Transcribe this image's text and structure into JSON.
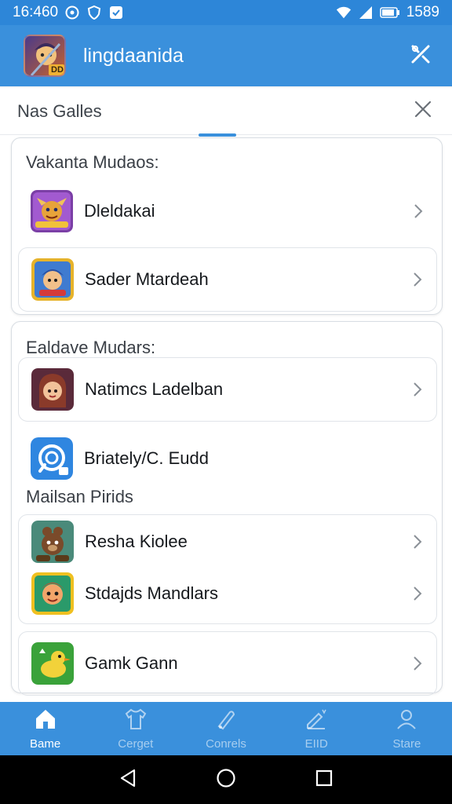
{
  "status_bar": {
    "time": "16:460",
    "battery": "1589",
    "icons": [
      "circle-info-icon",
      "shield-icon",
      "notification-icon",
      "wifi-icon",
      "signal-icon",
      "battery-icon"
    ]
  },
  "app_bar": {
    "title": "lingdaanida",
    "logo_badge": "DD",
    "action_icon": "tools-icon"
  },
  "sheet": {
    "title": "Nas Galles",
    "close_icon": "close-icon",
    "section1": {
      "heading": "Vakanta Mudaos:",
      "items": [
        {
          "label": "Dleldakai",
          "icon": "game-icon-purple"
        },
        {
          "label": "Sader Mtardeah",
          "icon": "game-icon-blue"
        }
      ]
    },
    "section2": {
      "heading": "Ealdave Mudars:",
      "items": [
        {
          "label": "Natimcs Ladelban",
          "icon": "game-icon-maroon"
        },
        {
          "label": "Briately/C. Eudd",
          "icon": "app-icon-blue"
        }
      ],
      "subheading": "Mailsan Pirids",
      "group_items": [
        {
          "label": "Resha Kiolee",
          "icon": "game-icon-brown"
        },
        {
          "label": "Stdajds Mandlars",
          "icon": "game-icon-yellow"
        }
      ],
      "last_item": {
        "label": "Gamk Gann",
        "icon": "game-icon-green"
      }
    }
  },
  "bottom_nav": {
    "items": [
      {
        "label": "Bame",
        "icon": "home-icon",
        "active": true
      },
      {
        "label": "Cerget",
        "icon": "shirt-icon",
        "active": false
      },
      {
        "label": "Conrels",
        "icon": "pen-icon",
        "active": false
      },
      {
        "label": "EIID",
        "icon": "edit-icon",
        "active": false
      },
      {
        "label": "Stare",
        "icon": "profile-icon",
        "active": false
      }
    ]
  },
  "colors": {
    "primary": "#3a90dc",
    "status_bar": "#2d86d8",
    "surface": "#ffffff",
    "text": "#16191d"
  }
}
